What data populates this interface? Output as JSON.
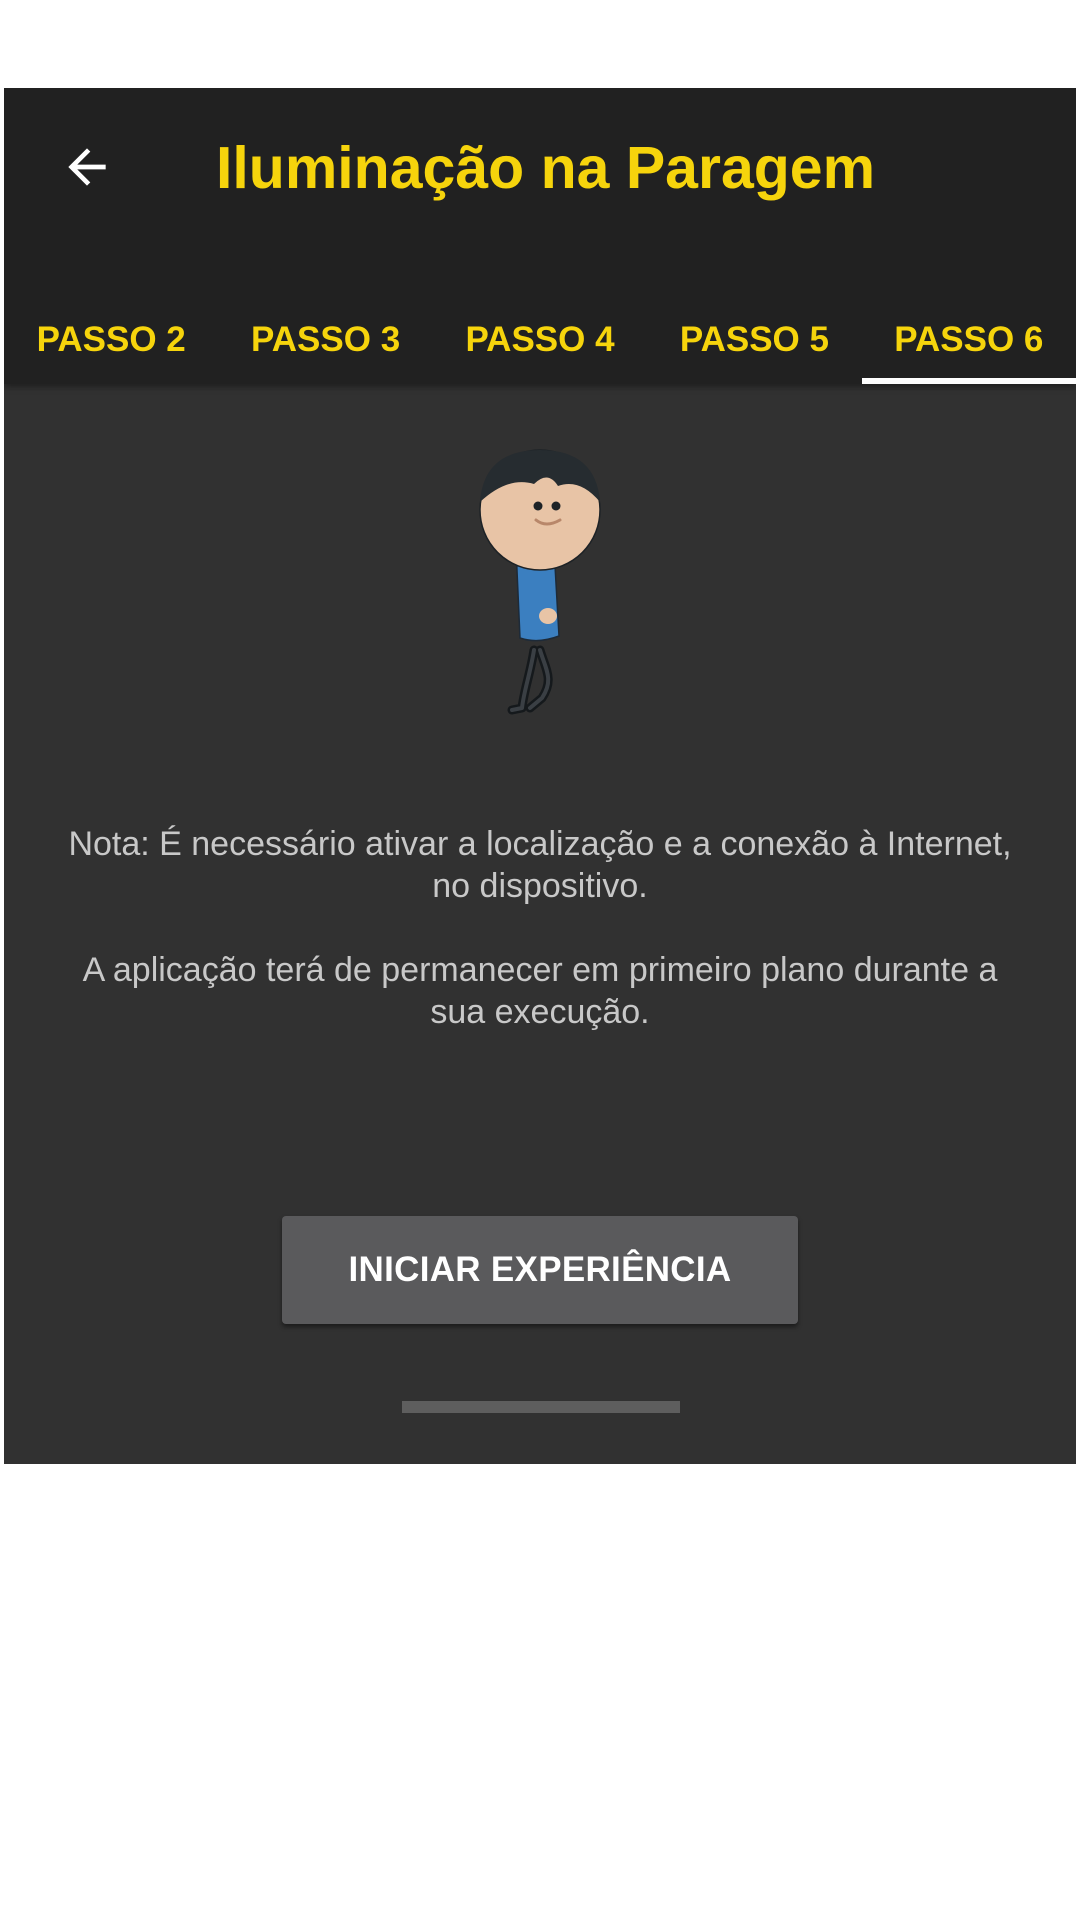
{
  "app_bar": {
    "title": "Iluminação na Paragem",
    "back_icon": "arrow-left-icon"
  },
  "tabs": [
    {
      "label": "PASSO 2",
      "active": false
    },
    {
      "label": "PASSO 3",
      "active": false
    },
    {
      "label": "PASSO 4",
      "active": false
    },
    {
      "label": "PASSO 5",
      "active": false
    },
    {
      "label": "PASSO 6",
      "active": true
    }
  ],
  "content": {
    "illustration": "walking-person-illustration",
    "note_1": "Nota: É necessário ativar a localização e a conexão à Internet, no dispositivo.",
    "note_2": "A aplicação terá de permanecer em primeiro plano durante a sua execução.",
    "start_button_label": "INICIAR EXPERIÊNCIA"
  },
  "colors": {
    "accent": "#f6d40c",
    "app_bar_bg": "#212121",
    "content_bg": "#313131",
    "button_bg": "#5a5a5c",
    "active_indicator": "#ffffff"
  }
}
